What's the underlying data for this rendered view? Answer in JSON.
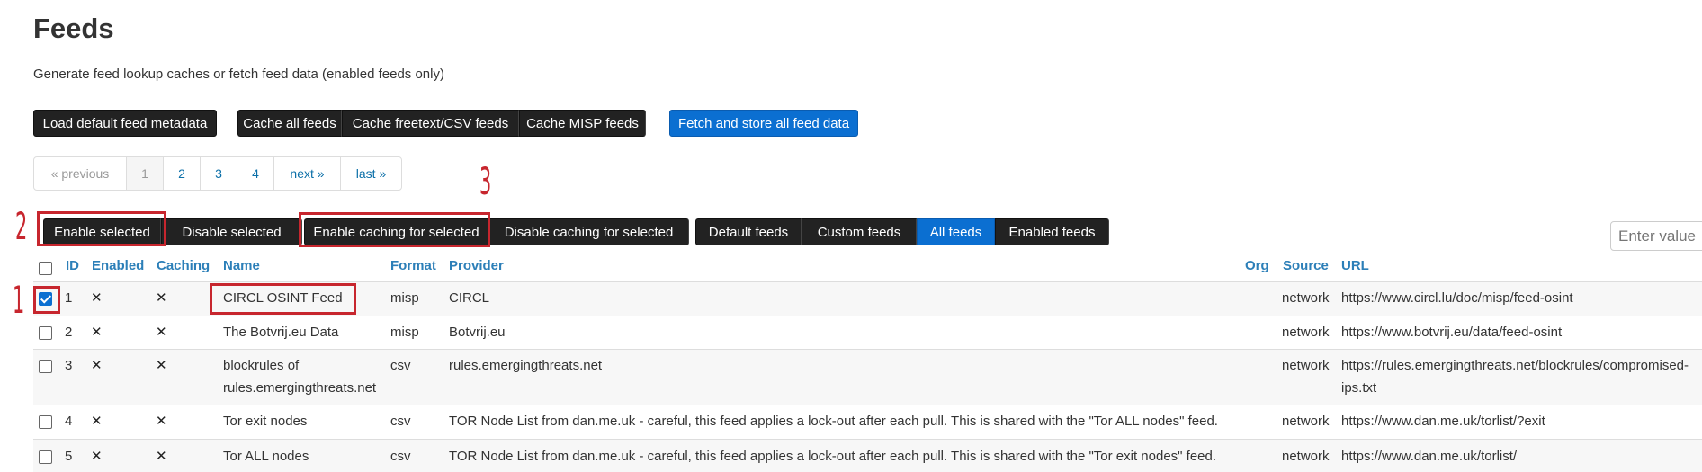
{
  "page": {
    "title": "Feeds",
    "subtitle": "Generate feed lookup caches or fetch feed data (enabled feeds only)"
  },
  "actions": {
    "load_default": "Load default feed metadata",
    "cache_all": "Cache all feeds",
    "cache_freetext": "Cache freetext/CSV feeds",
    "cache_misp": "Cache MISP feeds",
    "fetch_all": "Fetch and store all feed data"
  },
  "pagination": {
    "previous": "« previous",
    "pages": [
      "1",
      "2",
      "3",
      "4"
    ],
    "current_page": "1",
    "next": "next »",
    "last": "last »"
  },
  "bulk_actions": {
    "enable_selected": "Enable selected",
    "disable_selected": "Disable selected",
    "enable_caching": "Enable caching for selected",
    "disable_caching": "Disable caching for selected"
  },
  "filters": {
    "default_feeds": "Default feeds",
    "custom_feeds": "Custom feeds",
    "all_feeds": "All feeds",
    "enabled_feeds": "Enabled feeds",
    "active": "All feeds"
  },
  "search": {
    "placeholder": "Enter value"
  },
  "annotations": [
    "1",
    "2",
    "3"
  ],
  "table": {
    "headers": {
      "id": "ID",
      "enabled": "Enabled",
      "caching": "Caching",
      "name": "Name",
      "format": "Format",
      "provider": "Provider",
      "org": "Org",
      "source": "Source",
      "url": "URL"
    },
    "rows": [
      {
        "checked": true,
        "id": "1",
        "enabled": "✕",
        "caching": "✕",
        "name_lines": [
          "CIRCL OSINT Feed"
        ],
        "format": "misp",
        "provider": "CIRCL",
        "source": "network",
        "url_lines": [
          "https://www.circl.lu/doc/misp/feed-osint"
        ]
      },
      {
        "checked": false,
        "id": "2",
        "enabled": "✕",
        "caching": "✕",
        "name_lines": [
          "The Botvrij.eu Data"
        ],
        "format": "misp",
        "provider": "Botvrij.eu",
        "source": "network",
        "url_lines": [
          "https://www.botvrij.eu/data/feed-osint"
        ]
      },
      {
        "checked": false,
        "id": "3",
        "enabled": "✕",
        "caching": "✕",
        "name_lines": [
          "blockrules of",
          "rules.emergingthreats.net"
        ],
        "format": "csv",
        "provider": "rules.emergingthreats.net",
        "source": "network",
        "url_lines": [
          "https://rules.emergingthreats.net/blockrules/compromised-",
          "ips.txt"
        ]
      },
      {
        "checked": false,
        "id": "4",
        "enabled": "✕",
        "caching": "✕",
        "name_lines": [
          "Tor exit nodes"
        ],
        "format": "csv",
        "provider": "TOR Node List from dan.me.uk - careful, this feed applies a lock-out after each pull. This is shared with the \"Tor ALL nodes\" feed.",
        "source": "network",
        "url_lines": [
          "https://www.dan.me.uk/torlist/?exit"
        ]
      },
      {
        "checked": false,
        "id": "5",
        "enabled": "✕",
        "caching": "✕",
        "name_lines": [
          "Tor ALL nodes"
        ],
        "format": "csv",
        "provider": "TOR Node List from dan.me.uk - careful, this feed applies a lock-out after each pull. This is shared with the \"Tor exit nodes\" feed.",
        "source": "network",
        "url_lines": [
          "https://www.dan.me.uk/torlist/"
        ]
      }
    ]
  },
  "colors": {
    "annotation": "#c7262e",
    "primary": "#0b6fd1",
    "dark_button": "#222222",
    "link": "#2c7fb8"
  }
}
